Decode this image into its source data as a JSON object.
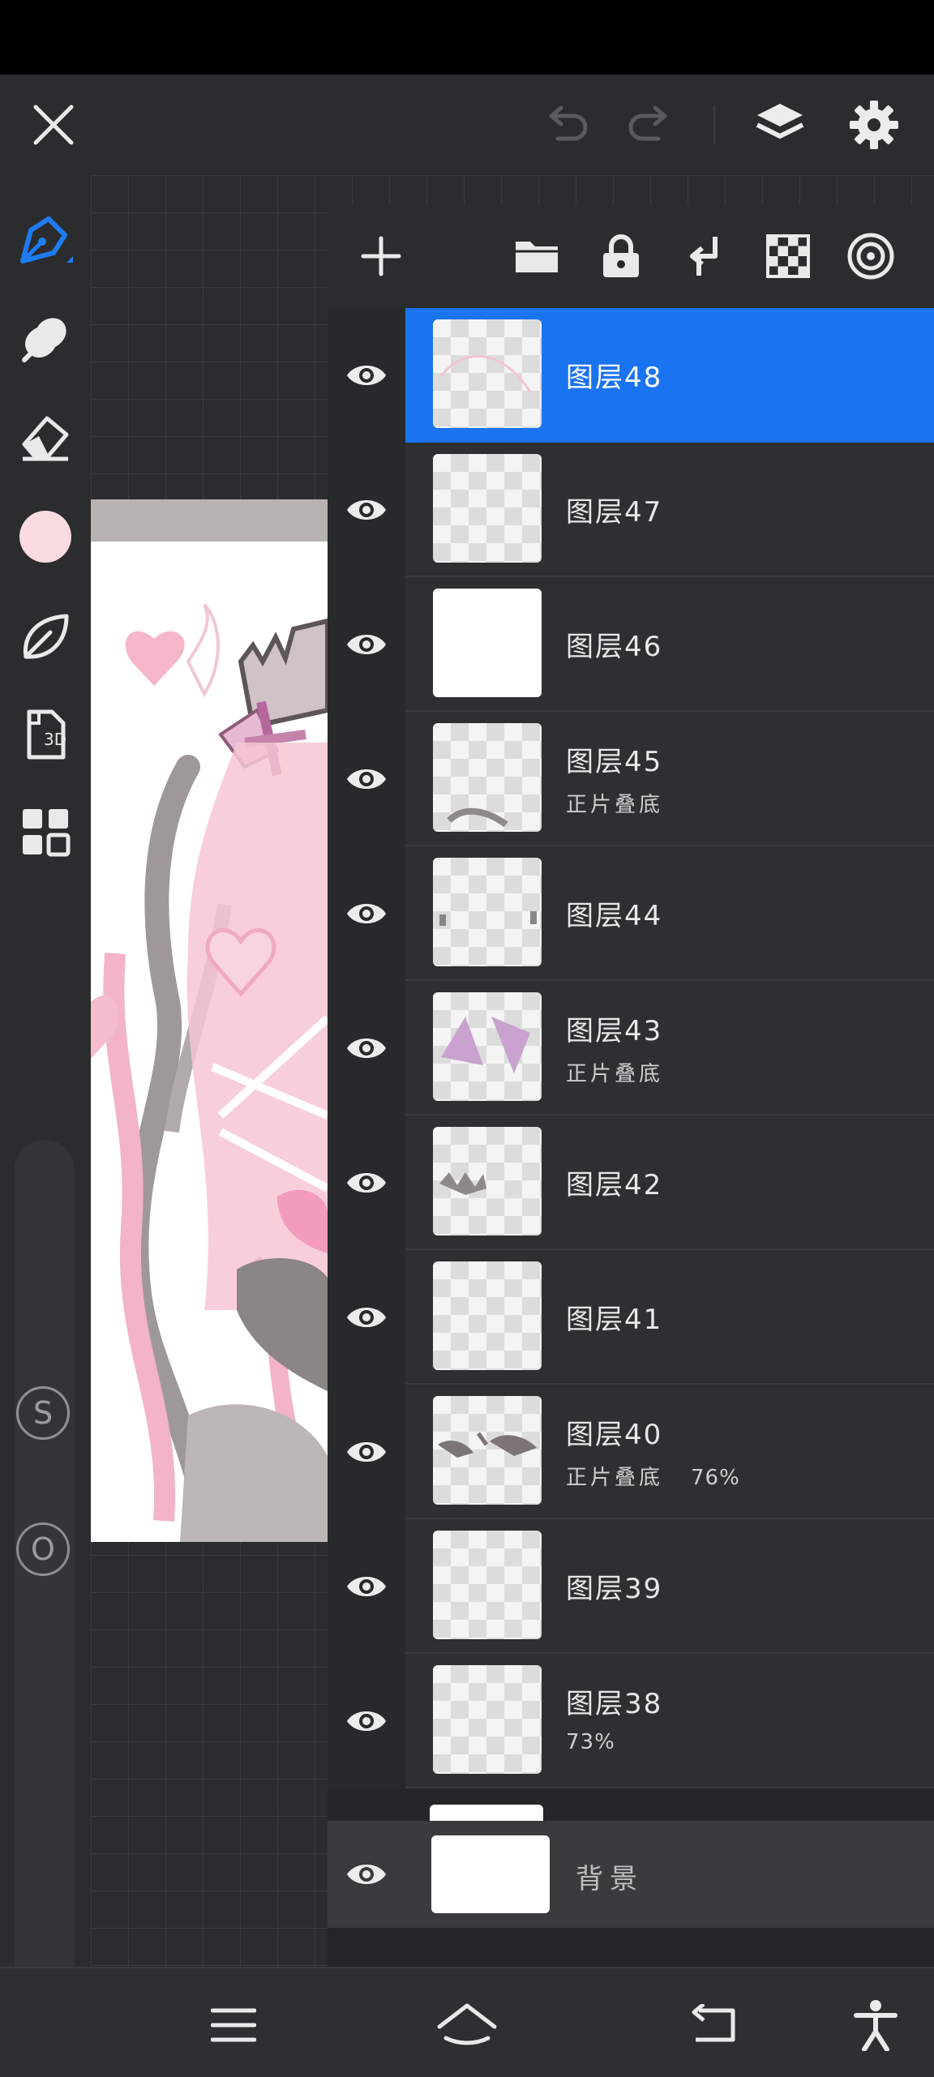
{
  "colors": {
    "accent": "#1a73f0",
    "current_color": "#fadbe0"
  },
  "topbar": {
    "close_icon": "close-icon",
    "undo_icon": "undo-icon",
    "redo_icon": "redo-icon",
    "layers_icon": "layers-icon",
    "settings_icon": "gear-icon"
  },
  "tools": [
    {
      "name": "pen",
      "icon": "pen-icon"
    },
    {
      "name": "smudge",
      "icon": "smudge-icon"
    },
    {
      "name": "eraser",
      "icon": "eraser-icon"
    },
    {
      "name": "color",
      "icon": "color-swatch"
    },
    {
      "name": "brush-library",
      "icon": "leaf-icon"
    },
    {
      "name": "3d",
      "icon": "3d-icon",
      "label": "3D"
    },
    {
      "name": "gallery",
      "icon": "grid-icon"
    }
  ],
  "sliders": {
    "size_label": "S",
    "opacity_label": "O"
  },
  "layers_toolbar": {
    "icons": [
      "add-icon",
      "folder-icon",
      "lock-icon",
      "merge-down-icon",
      "checker-icon",
      "target-icon"
    ]
  },
  "layers": [
    {
      "name": "图层48",
      "sub": "",
      "opacity": "",
      "selected": true
    },
    {
      "name": "图层47",
      "sub": "",
      "opacity": ""
    },
    {
      "name": "图层46",
      "sub": "",
      "opacity": "",
      "thumb": "white"
    },
    {
      "name": "图层45",
      "sub": "正片叠底",
      "opacity": ""
    },
    {
      "name": "图层44",
      "sub": "",
      "opacity": ""
    },
    {
      "name": "图层43",
      "sub": "正片叠底",
      "opacity": ""
    },
    {
      "name": "图层42",
      "sub": "",
      "opacity": ""
    },
    {
      "name": "图层41",
      "sub": "",
      "opacity": ""
    },
    {
      "name": "图层40",
      "sub": "正片叠底",
      "opacity": "76%"
    },
    {
      "name": "图层39",
      "sub": "",
      "opacity": ""
    },
    {
      "name": "图层38",
      "sub": "73%",
      "opacity": ""
    }
  ],
  "background_layer": {
    "name": "背景"
  },
  "navbar": {
    "icons": [
      "menu-icon",
      "home-icon",
      "back-icon",
      "accessibility-icon"
    ]
  }
}
